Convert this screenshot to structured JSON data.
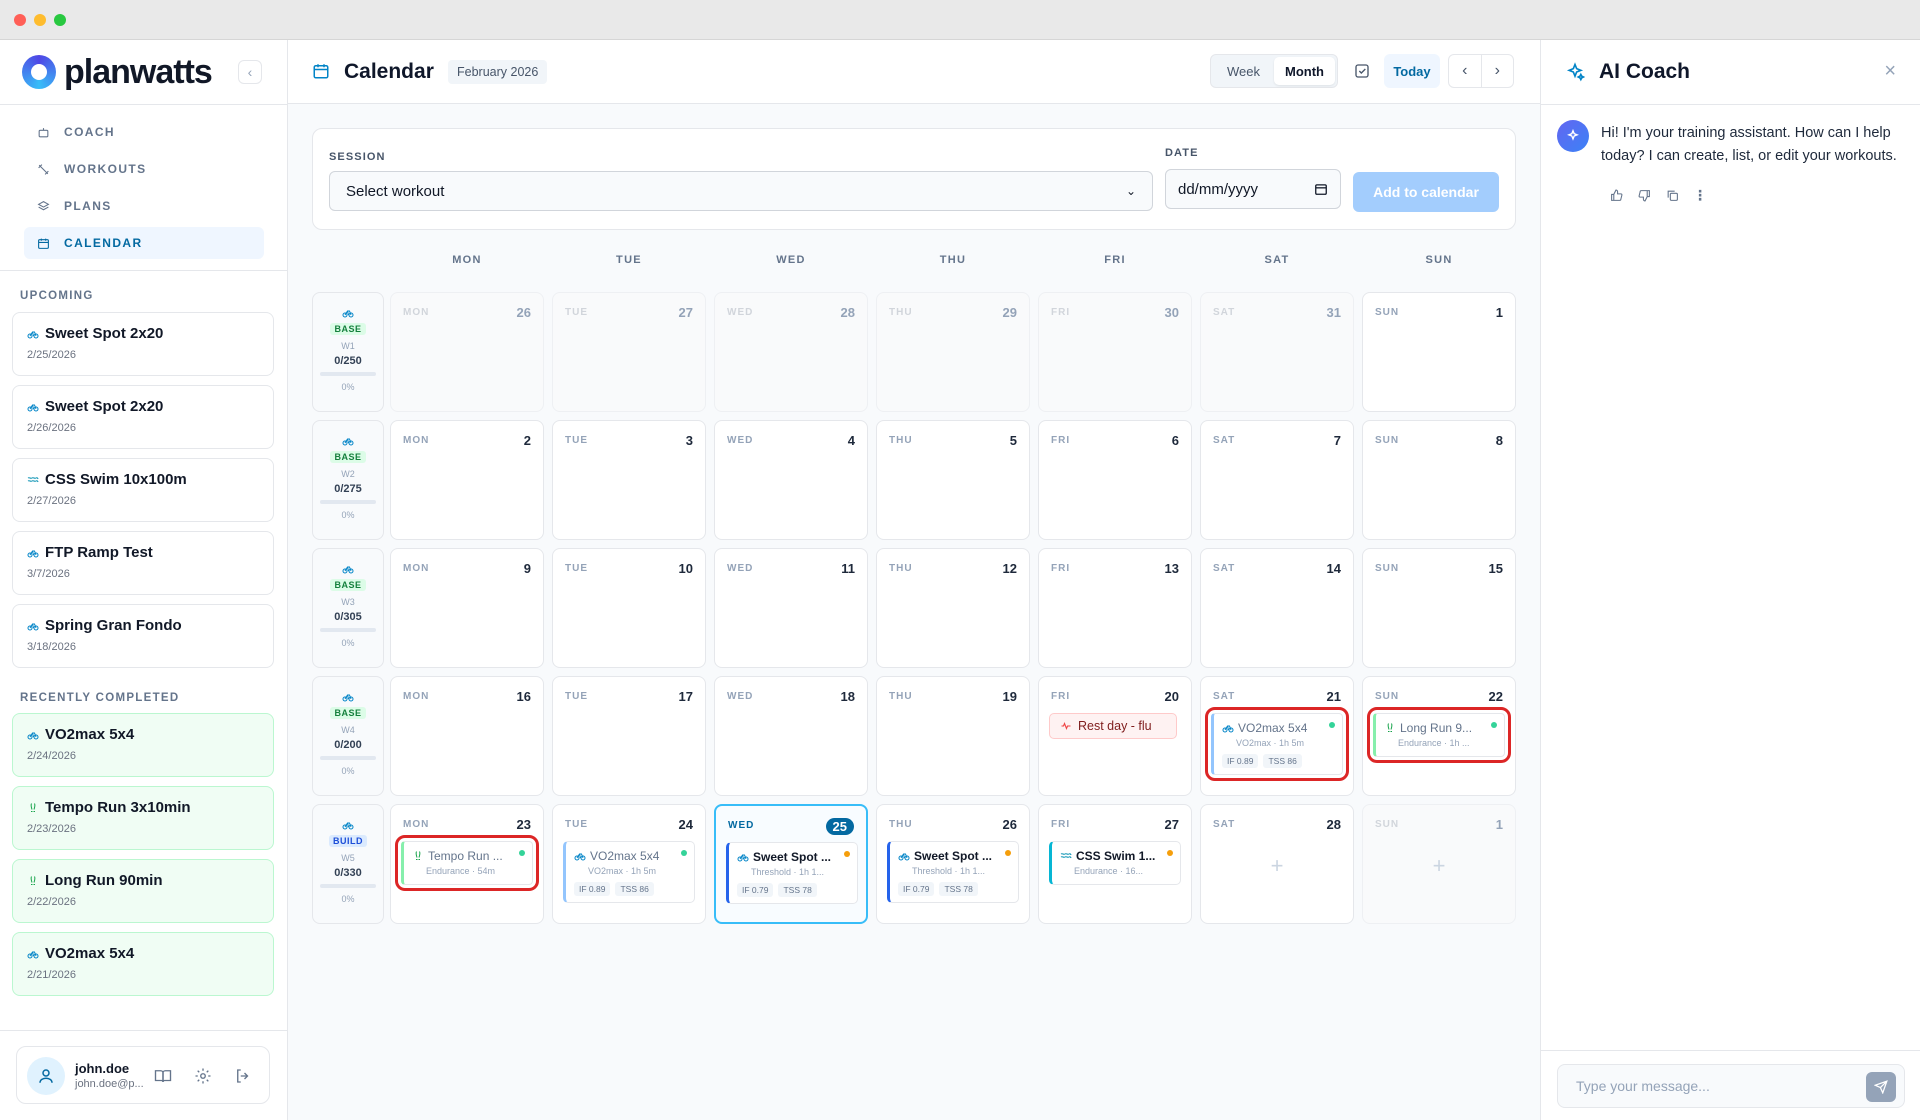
{
  "brand": {
    "name": "planwatts"
  },
  "nav": [
    {
      "label": "COACH",
      "icon": "robot-icon",
      "active": false
    },
    {
      "label": "WORKOUTS",
      "icon": "dumbbell-icon",
      "active": false
    },
    {
      "label": "PLANS",
      "icon": "layers-icon",
      "active": false
    },
    {
      "label": "CALENDAR",
      "icon": "calendar-icon",
      "active": true
    }
  ],
  "upcoming": {
    "label": "UPCOMING",
    "items": [
      {
        "title": "Sweet Spot 2x20",
        "date": "2/25/2026",
        "sport": "bike"
      },
      {
        "title": "Sweet Spot 2x20",
        "date": "2/26/2026",
        "sport": "bike"
      },
      {
        "title": "CSS Swim 10x100m",
        "date": "2/27/2026",
        "sport": "swim"
      },
      {
        "title": "FTP Ramp Test",
        "date": "3/7/2026",
        "sport": "bike"
      },
      {
        "title": "Spring Gran Fondo",
        "date": "3/18/2026",
        "sport": "bike"
      }
    ]
  },
  "completed": {
    "label": "RECENTLY COMPLETED",
    "items": [
      {
        "title": "VO2max 5x4",
        "date": "2/24/2026",
        "sport": "bike"
      },
      {
        "title": "Tempo Run 3x10min",
        "date": "2/23/2026",
        "sport": "run"
      },
      {
        "title": "Long Run 90min",
        "date": "2/22/2026",
        "sport": "run"
      },
      {
        "title": "VO2max 5x4",
        "date": "2/21/2026",
        "sport": "bike"
      }
    ]
  },
  "user": {
    "name": "john.doe",
    "email": "john.doe@p..."
  },
  "header": {
    "title": "Calendar",
    "month": "February 2026",
    "view_week": "Week",
    "view_month": "Month",
    "today": "Today"
  },
  "add": {
    "session_label": "SESSION",
    "session_value": "Select workout",
    "date_label": "DATE",
    "date_value": "dd/mm/yyyy",
    "button": "Add to calendar"
  },
  "days_of_week": [
    "MON",
    "TUE",
    "WED",
    "THU",
    "FRI",
    "SAT",
    "SUN"
  ],
  "weeks": [
    {
      "phase": "BASE",
      "week": "W1",
      "load": "0/250",
      "pct": "0%",
      "days": [
        {
          "label": "MON",
          "num": "26",
          "out": true
        },
        {
          "label": "TUE",
          "num": "27",
          "out": true
        },
        {
          "label": "WED",
          "num": "28",
          "out": true
        },
        {
          "label": "THU",
          "num": "29",
          "out": true
        },
        {
          "label": "FRI",
          "num": "30",
          "out": true
        },
        {
          "label": "SAT",
          "num": "31",
          "out": true
        },
        {
          "label": "SUN",
          "num": "1"
        }
      ]
    },
    {
      "phase": "BASE",
      "week": "W2",
      "load": "0/275",
      "pct": "0%",
      "days": [
        {
          "label": "MON",
          "num": "2"
        },
        {
          "label": "TUE",
          "num": "3"
        },
        {
          "label": "WED",
          "num": "4"
        },
        {
          "label": "THU",
          "num": "5"
        },
        {
          "label": "FRI",
          "num": "6"
        },
        {
          "label": "SAT",
          "num": "7"
        },
        {
          "label": "SUN",
          "num": "8"
        }
      ]
    },
    {
      "phase": "BASE",
      "week": "W3",
      "load": "0/305",
      "pct": "0%",
      "days": [
        {
          "label": "MON",
          "num": "9"
        },
        {
          "label": "TUE",
          "num": "10"
        },
        {
          "label": "WED",
          "num": "11"
        },
        {
          "label": "THU",
          "num": "12"
        },
        {
          "label": "FRI",
          "num": "13"
        },
        {
          "label": "SAT",
          "num": "14"
        },
        {
          "label": "SUN",
          "num": "15"
        }
      ]
    },
    {
      "phase": "BASE",
      "week": "W4",
      "load": "0/200",
      "pct": "0%",
      "days": [
        {
          "label": "MON",
          "num": "16"
        },
        {
          "label": "TUE",
          "num": "17"
        },
        {
          "label": "WED",
          "num": "18"
        },
        {
          "label": "THU",
          "num": "19"
        },
        {
          "label": "FRI",
          "num": "20",
          "rest": "Rest day - flu"
        },
        {
          "label": "SAT",
          "num": "21",
          "workout": {
            "name": "VO2max 5x4",
            "sub": "VO2max · 1h 5m",
            "if": "IF 0.89",
            "tss": "TSS 86",
            "sport": "bike",
            "dot": "#34d399",
            "bar": "#93c5fd",
            "faded": true,
            "hl": true
          }
        },
        {
          "label": "SUN",
          "num": "22",
          "workout": {
            "name": "Long Run 9...",
            "sub": "Endurance · 1h ...",
            "sport": "run",
            "dot": "#34d399",
            "bar": "#86efac",
            "faded": true,
            "hl": true,
            "short": true
          }
        }
      ]
    },
    {
      "phase": "BUILD",
      "week": "W5",
      "load": "0/330",
      "pct": "0%",
      "days": [
        {
          "label": "MON",
          "num": "23",
          "workout": {
            "name": "Tempo Run ...",
            "sub": "Endurance · 54m",
            "sport": "run",
            "dot": "#34d399",
            "bar": "#86efac",
            "faded": true,
            "hl": true,
            "short": true
          }
        },
        {
          "label": "TUE",
          "num": "24",
          "workout": {
            "name": "VO2max 5x4",
            "sub": "VO2max · 1h 5m",
            "if": "IF 0.89",
            "tss": "TSS 86",
            "sport": "bike",
            "dot": "#34d399",
            "bar": "#93c5fd",
            "faded": true
          }
        },
        {
          "label": "WED",
          "num": "25",
          "today": true,
          "workout": {
            "name": "Sweet Spot ...",
            "sub": "Threshold · 1h 1...",
            "if": "IF 0.79",
            "tss": "TSS 78",
            "sport": "bike",
            "dot": "#f59e0b",
            "bar": "#2563eb"
          }
        },
        {
          "label": "THU",
          "num": "26",
          "workout": {
            "name": "Sweet Spot ...",
            "sub": "Threshold · 1h 1...",
            "if": "IF 0.79",
            "tss": "TSS 78",
            "sport": "bike",
            "dot": "#f59e0b",
            "bar": "#2563eb"
          }
        },
        {
          "label": "FRI",
          "num": "27",
          "workout": {
            "name": "CSS Swim 1...",
            "sub": "Endurance · 16...",
            "sport": "swim",
            "dot": "#f59e0b",
            "bar": "#06b6d4",
            "short": true
          }
        },
        {
          "label": "SAT",
          "num": "28",
          "plus": "+"
        },
        {
          "label": "SUN",
          "num": "1",
          "out": true,
          "plus": "+"
        }
      ]
    }
  ],
  "coach": {
    "title": "AI Coach",
    "message": "Hi! I'm your training assistant. How can I help today? I can create, list, or edit your workouts.",
    "placeholder": "Type your message..."
  },
  "colors": {
    "accent": "#0369a1",
    "today_border": "#38bdf8",
    "highlight": "#dc2626",
    "completed_bg": "#f0fdf4"
  }
}
